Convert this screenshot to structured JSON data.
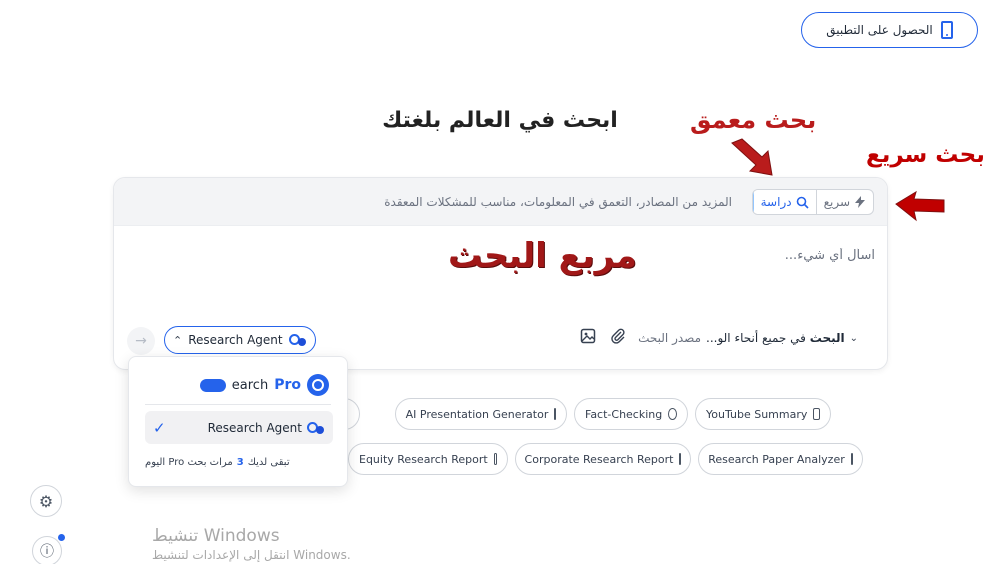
{
  "header": {
    "get_app_label": "الحصول على التطبيق"
  },
  "page_title": "ابحث في العالم بلغتك",
  "annotations": {
    "deep_search": "بحث معمق",
    "quick_search": "بحث سريع",
    "search_box": "مربع البحث"
  },
  "mode_bar": {
    "quick_label": "سريع",
    "research_label": "دراسة",
    "description": "المزيد من المصادر، التعمق في المعلومات، مناسب للمشكلات المعقدة"
  },
  "query": {
    "placeholder": "اسأل أي شيء..."
  },
  "bottom_bar": {
    "source_label": "مصدر البحث",
    "source_bold": "البحث",
    "source_value": "في جميع أنحاء الو...",
    "agent_label": "Research Agent",
    "submit_arrow": "→"
  },
  "suggestions": [
    {
      "label": "AI Presentation Generator",
      "icon": "slides-icon"
    },
    {
      "label": "Fact-Checking",
      "icon": "check-circle-icon"
    },
    {
      "label": "YouTube Summary",
      "icon": "video-icon"
    },
    {
      "label": "Equity Research Report",
      "icon": "bank-icon"
    },
    {
      "label": "Corporate Research Report",
      "icon": "presentation-icon"
    },
    {
      "label": "Research Paper Analyzer",
      "icon": "document-icon"
    }
  ],
  "partial_chip_text": "n",
  "dropdown": {
    "pro_item_label": "earch",
    "pro_tag": "Pro",
    "agent_item_label": "Research Agent",
    "remaining_prefix": "تبقى لديك",
    "remaining_count": "3",
    "remaining_suffix": "مرات بحث Pro اليوم"
  },
  "activation": {
    "title": "تنشيط Windows",
    "subtitle": "انتقل إلى الإعدادات لتنشيط Windows."
  },
  "colors": {
    "accent": "#2563eb",
    "annotation_red": "#b91c1c"
  }
}
